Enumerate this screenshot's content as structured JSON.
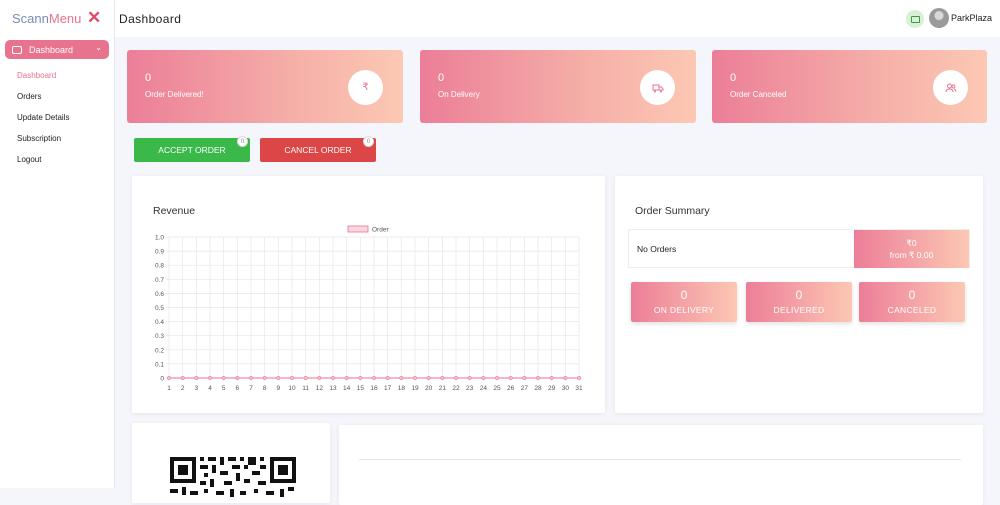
{
  "brand": {
    "part1": "Scann",
    "part2": "Menu"
  },
  "sidebar": {
    "dashboard_button": "Dashboard",
    "items": [
      {
        "label": "Dashboard",
        "active": true
      },
      {
        "label": "Orders",
        "active": false
      },
      {
        "label": "Update Details",
        "active": false
      },
      {
        "label": "Subscription",
        "active": false
      },
      {
        "label": "Logout",
        "active": false
      }
    ]
  },
  "header": {
    "title": "Dashboard",
    "user_name": "ParkPlaza"
  },
  "stats": [
    {
      "value": "0",
      "label": "Order Delivered!",
      "icon": "₹"
    },
    {
      "value": "0",
      "label": "On Delivery",
      "icon": "truck-icon"
    },
    {
      "value": "0",
      "label": "Order Canceled",
      "icon": "users-icon"
    }
  ],
  "actions": {
    "accept": {
      "label": "ACCEPT ORDER",
      "count": "0",
      "color": "#3ab84a"
    },
    "cancel": {
      "label": "CANCEL ORDER",
      "count": "0",
      "color": "#dc4646"
    }
  },
  "revenue": {
    "title": "Revenue"
  },
  "chart_data": {
    "type": "line",
    "title": "Revenue",
    "series": [
      {
        "name": "Order",
        "values": [
          0,
          0,
          0,
          0,
          0,
          0,
          0,
          0,
          0,
          0,
          0,
          0,
          0,
          0,
          0,
          0,
          0,
          0,
          0,
          0,
          0,
          0,
          0,
          0,
          0,
          0,
          0,
          0,
          0,
          0,
          0
        ]
      }
    ],
    "x": [
      1,
      2,
      3,
      4,
      5,
      6,
      7,
      8,
      9,
      10,
      11,
      12,
      13,
      14,
      15,
      16,
      17,
      18,
      19,
      20,
      21,
      22,
      23,
      24,
      25,
      26,
      27,
      28,
      29,
      30,
      31
    ],
    "y_ticks": [
      "0",
      "0.1",
      "0.2",
      "0.3",
      "0.4",
      "0.5",
      "0.6",
      "0.7",
      "0.8",
      "0.9",
      "1.0"
    ],
    "ylim": [
      0,
      1
    ],
    "grid": true,
    "legend": "top-center",
    "color": "#e8738f"
  },
  "order_summary": {
    "title": "Order Summary",
    "no_orders": "No Orders",
    "amount": "₹0",
    "from": "from ₹ 0.00",
    "boxes": [
      {
        "value": "0",
        "label": "ON DELIVERY"
      },
      {
        "value": "0",
        "label": "DELIVERED"
      },
      {
        "value": "0",
        "label": "CANCELED"
      }
    ]
  }
}
